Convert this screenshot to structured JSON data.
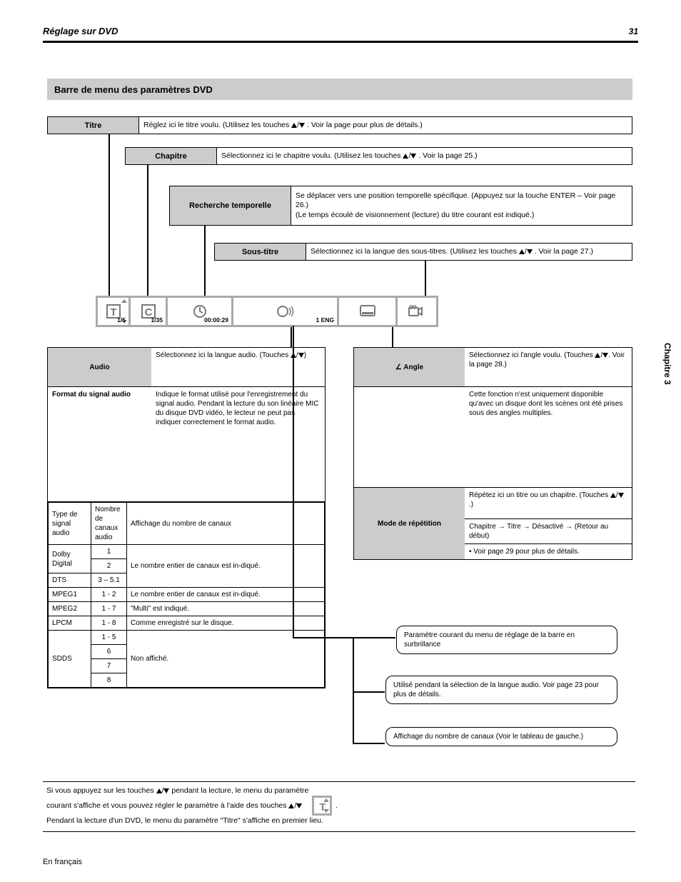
{
  "page": {
    "section_title": "Réglage sur DVD",
    "page_number": "31",
    "chapter": "Chapitre 3",
    "footer_line1": "En français",
    "menu_bar_heading": "Barre de menu des paramètres DVD"
  },
  "bars": {
    "title": {
      "label": "Titre",
      "text_pre": "Réglez ici le titre voulu. (Utilisez les touches",
      "text_post": ". Voir la page pour plus de détails.)"
    },
    "chapter": {
      "label": "Chapitre",
      "text_pre": "Sélectionnez ici le chapitre voulu. (Utilisez les touches",
      "text_post": ". Voir la page 25.)"
    },
    "timesearch": {
      "label": "Recherche temporelle",
      "line1": "Se déplacer vers une position temporelle spécifique. (Appuyez sur la touche ENTER – Voir page 26.)",
      "line2": "(Le temps écoulé de visionnement (lecture) du titre courant est indiqué.)"
    },
    "subtitle": {
      "label": "Sous-titre",
      "text_pre": "Sélectionnez ici la langue des sous-titres. (Utilisez les touches",
      "text_post": ". Voir la page 27.)"
    }
  },
  "iconbar": {
    "cells": {
      "title_val": "1/5",
      "chapter_val": "1/35",
      "time_val": "00:00:29",
      "audio_val": "1 ENG",
      "sub_caps": {
        "t": "T",
        "c": "C",
        "clock": "",
        "audio": "",
        "subtitle": "",
        "angle": ""
      }
    }
  },
  "audio_panel": {
    "header": {
      "label": "Audio",
      "text_pre": "Sélectionnez ici la langue audio. (Touches",
      "text_post": ")"
    },
    "format_box": {
      "label": "Format du signal audio",
      "body": "Indique le format utilisé pour l'enregistrement du signal audio. Pendant la lecture du son linéaire MIC du disque DVD vidéo, le lecteur ne peut pas indiquer correctement le format audio."
    },
    "table": {
      "col1": "Type de signal audio",
      "col2": "Nombre de canaux audio",
      "col3": "Affichage du nombre de canaux",
      "rows": [
        {
          "c1": "Dolby Digital",
          "c2_top": "1",
          "c2_bot": "2",
          "c3": "Le nombre entier de canaux est in-diqué."
        },
        {
          "c1": "DTS",
          "c2_top": "3 - 5",
          "c2_bot": "5",
          "c3": "\"Multi\" est indiqué."
        },
        {
          "c1": "MPEG1",
          "c2": "1 - 2",
          "c3": "Le nombre entier de canaux est in-diqué."
        },
        {
          "c1": "MPEG2",
          "c2": "1 - 7",
          "c3": "\"Multi\" est indiqué."
        },
        {
          "c1": "LPCM",
          "c2": "1 - 8",
          "c3": "Comme enregistré sur le disque."
        },
        {
          "c1": "SDDS",
          "c2_rows": [
            "1 - 5",
            "6",
            "7",
            "8"
          ],
          "c3": "Non affiché."
        }
      ]
    }
  },
  "angle_panel": {
    "header": {
      "label": "∠ Angle",
      "text_pre": "Sélectionnez ici l'angle voulu. (Touches",
      "text_post": ". Voir la page 28.)"
    },
    "body": "Cette fonction n'est uniquement disponible qu'avec un disque dont les scènes ont été prises sous des angles multiples.",
    "repeat": {
      "label": "Mode de répétition",
      "row1_pre": "Répétez ici un titre ou un chapitre. (Touches",
      "row1_post": ".)",
      "row2": "Chapitre → Titre → Désactivé → (Retour au début)",
      "row3": "• Voir page 29 pour plus de détails."
    }
  },
  "callouts": {
    "c1": "Paramètre courant du menu de réglage de la barre en surbrillance",
    "c2": "Utilisé pendant la sélection de la langue audio. Voir page 23 pour plus de détails.",
    "c3": "Affichage du nombre de canaux (Voir le tableau de gauche.)"
  },
  "footnote": {
    "pre1": "Si vous appuyez sur les touches ",
    "mid": "/",
    "post1": " pendant la lecture, le menu du paramètre",
    "line2_pre": "courant s'affiche et vous pouvez régler le paramètre à l'aide des touches ",
    "line2_post": ".",
    "line3": "Pendant la lecture d'un DVD, le menu du paramètre \"Titre\" s'affiche en premier lieu."
  }
}
